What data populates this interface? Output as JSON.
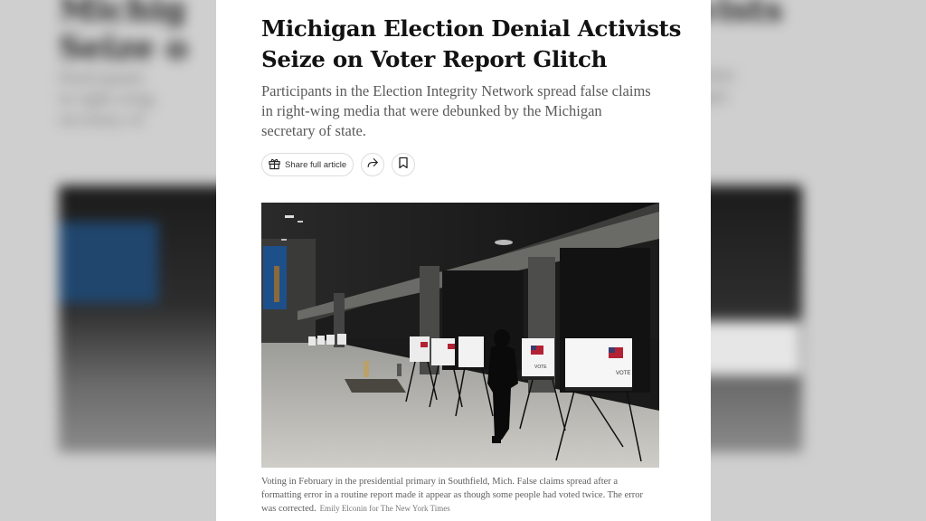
{
  "article": {
    "headline": "Michigan Election Denial Activists Seize on Voter Report Glitch",
    "summary": "Participants in the Election Integrity Network spread false claims in right-wing media that were debunked by the Michigan secretary of state.",
    "share_label": "Share full article",
    "icons": {
      "gift": "gift-icon",
      "share": "share-arrow-icon",
      "bookmark": "bookmark-icon"
    },
    "photo": {
      "booth_label": "VOTE"
    },
    "caption": "Voting in February in the presidential primary in Southfield, Mich. False claims spread after a formatting error in a routine report made it appear as though some people had voted twice. The error was corrected.",
    "credit": "Emily Elconin for The New York Times"
  },
  "backdrop": {
    "headline_left": "Michig\nSeize o",
    "headline_right": "ivists",
    "summary_left": "Participants\nin right-wing\nsecretary of",
    "summary_right": "claims\nhigan"
  },
  "colors": {
    "page_bg": "#ffffff",
    "headline": "#121212",
    "summary": "#5a5a5a",
    "flag_red": "#b22234",
    "flag_blue": "#3c3b6e"
  }
}
